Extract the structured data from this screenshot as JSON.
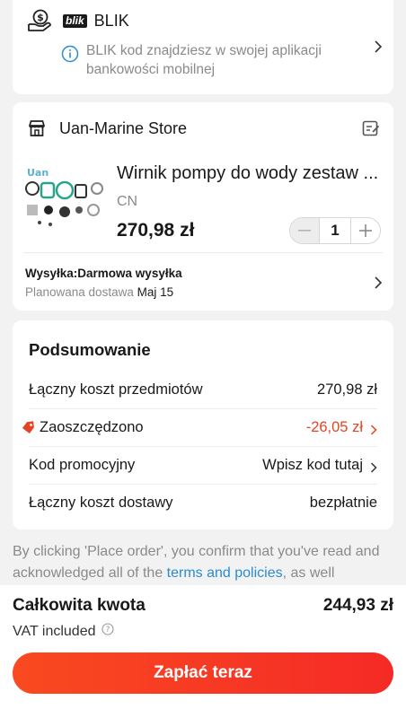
{
  "payment": {
    "method": "BLIK",
    "logo_text": "blik",
    "info": "BLIK kod znajdziesz w swojej aplikacji bankowości mobilnej"
  },
  "store": {
    "name": "Uan-Marine Store",
    "product": {
      "title": "Wirnik pompy do wody zestaw ...",
      "variant": "CN",
      "price": "270,98 zł",
      "quantity": "1"
    },
    "shipping": {
      "label": "Wysyłka:Darmowa wysyłka",
      "delivery_label": "Planowana dostawa",
      "delivery_date": "Maj 15"
    }
  },
  "summary": {
    "title": "Podsumowanie",
    "items_total_label": "Łączny koszt przedmiotów",
    "items_total_value": "270,98 zł",
    "saved_label": "Zaoszczędzono",
    "saved_value": "-26,05 zł",
    "promo_label": "Kod promocyjny",
    "promo_value": "Wpisz kod tutaj",
    "shipping_label": "Łączny koszt dostawy",
    "shipping_value": "bezpłatnie"
  },
  "disclaimer": {
    "prefix": "By clicking 'Place order', you confirm that you've read and acknowledged all of the ",
    "link": "terms and policies",
    "suffix": ", as well"
  },
  "footer": {
    "total_label": "Całkowita kwota",
    "total_value": "244,93 zł",
    "vat": "VAT included",
    "pay_button": "Zapłać teraz"
  },
  "colors": {
    "accent": "#f52a26",
    "discount": "#e64322",
    "link": "#2a8bd1",
    "info": "#2a8bd1"
  }
}
